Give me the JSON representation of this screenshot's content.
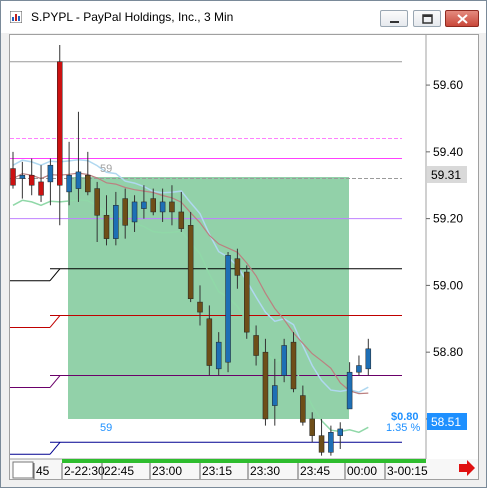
{
  "window": {
    "title": "S.PYPL - PayPal Holdings, Inc., 3 Min",
    "minimize_icon": "minimize-icon",
    "maximize_icon": "restore-icon",
    "close_icon": "close-icon"
  },
  "chart_data": {
    "type": "candlestick",
    "symbol": "S.PYPL",
    "title": "S.PYPL - PayPal Holdings, Inc., 3 Min",
    "y_ticks": [
      "59.60",
      "59.40",
      "59.20",
      "59.00",
      "58.80",
      "58.60"
    ],
    "ylim": [
      58.48,
      59.75
    ],
    "last_price_label": "59.31",
    "current_price_label": "58.51",
    "x_ticks": [
      "45",
      "2-22:30",
      "22:45",
      "23:00",
      "23:15",
      "23:30",
      "23:45",
      "00:00",
      "3-00:15"
    ],
    "annotations": {
      "count_label_top": "59",
      "count_label_bottom": "59",
      "change_value": "$0.80",
      "change_percent": "1.35 %"
    },
    "candles": [
      {
        "o": 59.35,
        "h": 59.4,
        "l": 59.29,
        "c": 59.3
      },
      {
        "o": 59.32,
        "h": 59.37,
        "l": 59.26,
        "c": 59.33
      },
      {
        "o": 59.33,
        "h": 59.38,
        "l": 59.27,
        "c": 59.3
      },
      {
        "o": 59.31,
        "h": 59.36,
        "l": 59.25,
        "c": 59.27
      },
      {
        "o": 59.31,
        "h": 59.38,
        "l": 59.24,
        "c": 59.36
      },
      {
        "o": 59.67,
        "h": 59.72,
        "l": 59.18,
        "c": 59.3
      },
      {
        "o": 59.28,
        "h": 59.43,
        "l": 59.24,
        "c": 59.33
      },
      {
        "o": 59.29,
        "h": 59.52,
        "l": 59.25,
        "c": 59.34
      },
      {
        "o": 59.33,
        "h": 59.4,
        "l": 59.27,
        "c": 59.28
      },
      {
        "o": 59.29,
        "h": 59.31,
        "l": 59.13,
        "c": 59.21
      },
      {
        "o": 59.21,
        "h": 59.27,
        "l": 59.12,
        "c": 59.14
      },
      {
        "o": 59.14,
        "h": 59.28,
        "l": 59.12,
        "c": 59.24
      },
      {
        "o": 59.26,
        "h": 59.29,
        "l": 59.14,
        "c": 59.18
      },
      {
        "o": 59.19,
        "h": 59.27,
        "l": 59.16,
        "c": 59.25
      },
      {
        "o": 59.23,
        "h": 59.3,
        "l": 59.2,
        "c": 59.25
      },
      {
        "o": 59.26,
        "h": 59.29,
        "l": 59.21,
        "c": 59.22
      },
      {
        "o": 59.22,
        "h": 59.29,
        "l": 59.19,
        "c": 59.25
      },
      {
        "o": 59.25,
        "h": 59.3,
        "l": 59.18,
        "c": 59.22
      },
      {
        "o": 59.22,
        "h": 59.28,
        "l": 59.16,
        "c": 59.17
      },
      {
        "o": 59.18,
        "h": 59.22,
        "l": 58.95,
        "c": 58.96
      },
      {
        "o": 58.95,
        "h": 59.0,
        "l": 58.88,
        "c": 58.92
      },
      {
        "o": 58.9,
        "h": 58.94,
        "l": 58.73,
        "c": 58.76
      },
      {
        "o": 58.75,
        "h": 58.86,
        "l": 58.73,
        "c": 58.83
      },
      {
        "o": 58.77,
        "h": 59.1,
        "l": 58.74,
        "c": 59.09
      },
      {
        "o": 59.08,
        "h": 59.11,
        "l": 58.99,
        "c": 59.03
      },
      {
        "o": 59.04,
        "h": 59.06,
        "l": 58.84,
        "c": 58.86
      },
      {
        "o": 58.85,
        "h": 58.88,
        "l": 58.76,
        "c": 58.79
      },
      {
        "o": 58.8,
        "h": 58.84,
        "l": 58.58,
        "c": 58.6
      },
      {
        "o": 58.64,
        "h": 58.78,
        "l": 58.58,
        "c": 58.7
      },
      {
        "o": 58.73,
        "h": 58.84,
        "l": 58.71,
        "c": 58.82
      },
      {
        "o": 58.83,
        "h": 58.86,
        "l": 58.68,
        "c": 58.69
      },
      {
        "o": 58.67,
        "h": 58.7,
        "l": 58.58,
        "c": 58.59
      },
      {
        "o": 58.6,
        "h": 58.62,
        "l": 58.53,
        "c": 58.55
      },
      {
        "o": 58.55,
        "h": 58.6,
        "l": 58.49,
        "c": 58.5
      },
      {
        "o": 58.5,
        "h": 58.58,
        "l": 58.49,
        "c": 58.56
      },
      {
        "o": 58.55,
        "h": 58.59,
        "l": 58.51,
        "c": 58.57
      },
      {
        "o": 58.63,
        "h": 58.77,
        "l": 58.63,
        "c": 58.74
      },
      {
        "o": 58.74,
        "h": 58.79,
        "l": 58.73,
        "c": 58.76
      },
      {
        "o": 58.75,
        "h": 58.84,
        "l": 58.73,
        "c": 58.81
      }
    ],
    "horizontal_lines": [
      {
        "price": 59.67,
        "color": "#9a9a9a"
      },
      {
        "price": 59.44,
        "color": "#ff80ff",
        "dashed": true
      },
      {
        "price": 59.38,
        "color": "#ff40ff"
      },
      {
        "price": 59.32,
        "color": "#9a9a9a",
        "dashed": true
      },
      {
        "price": 59.2,
        "color": "#c080ff"
      },
      {
        "price": 59.05,
        "color": "#000000"
      },
      {
        "price": 58.91,
        "color": "#c00000"
      },
      {
        "price": 58.73,
        "color": "#6a006a"
      },
      {
        "price": 58.53,
        "color": "#000090"
      }
    ],
    "colors": {
      "bullish": "#1e6fb5",
      "bearish": "#6e4e18",
      "bearish_highlight": "#cc1111",
      "highlight_box": "#7fc99a",
      "band_upper": "#b0d8f0",
      "band_lower": "#90d8a8",
      "ma_line": "#bb8080",
      "current_price_bg": "#1e90ff",
      "last_price_bg": "#d9d9d9",
      "arrow": "#e01010"
    }
  }
}
